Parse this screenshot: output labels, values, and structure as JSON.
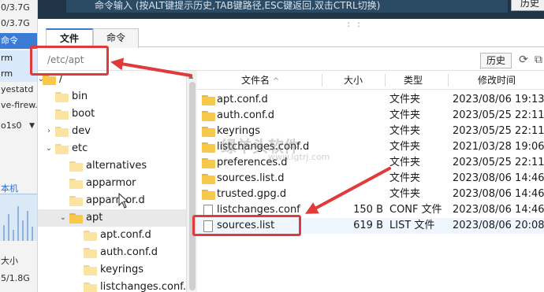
{
  "left_strip": {
    "rows": [
      {
        "text": "0/3.7G"
      },
      {
        "text": "0/3.7G"
      },
      {
        "text": "命令"
      },
      {
        "text": "rm"
      },
      {
        "text": "rm"
      },
      {
        "text": "yestatd"
      },
      {
        "text": "ve-firew."
      },
      {
        "text": "o1s0"
      },
      {
        "text": "本机"
      },
      {
        "text": "大小"
      },
      {
        "text": "5/1.8G"
      }
    ]
  },
  "topbar": {
    "command_input_text": "命令输入 (按ALT键提示历史,TAB键路径,ESC键返回,双击CTRL切换)",
    "history_label": "历史"
  },
  "tabs": [
    {
      "label": "文件",
      "active": true
    },
    {
      "label": "命令",
      "active": false
    }
  ],
  "pathbar": {
    "path": "/etc/apt",
    "history_label": "历史"
  },
  "tree": {
    "items": [
      {
        "label": "/",
        "depth": 0,
        "expanded": true
      },
      {
        "label": "bin",
        "depth": 1
      },
      {
        "label": "boot",
        "depth": 1
      },
      {
        "label": "dev",
        "depth": 1
      },
      {
        "label": "etc",
        "depth": 1,
        "expanded": true
      },
      {
        "label": "alternatives",
        "depth": 2
      },
      {
        "label": "apparmor",
        "depth": 2
      },
      {
        "label": "apparmor.d",
        "depth": 2
      },
      {
        "label": "apt",
        "depth": 2,
        "expanded": true,
        "selected": true
      },
      {
        "label": "apt.conf.d",
        "depth": 3
      },
      {
        "label": "auth.conf.d",
        "depth": 3
      },
      {
        "label": "keyrings",
        "depth": 3
      },
      {
        "label": "listchanges.conf.d",
        "depth": 3
      }
    ]
  },
  "file_list": {
    "headers": {
      "name": "文件名",
      "size": "大小",
      "type": "类型",
      "modified": "修改时间"
    },
    "rows": [
      {
        "name": "apt.conf.d",
        "size": "",
        "type": "文件夹",
        "modified": "2023/08/06 19:13",
        "is_folder": true
      },
      {
        "name": "auth.conf.d",
        "size": "",
        "type": "文件夹",
        "modified": "2023/05/25 22:11",
        "is_folder": true
      },
      {
        "name": "keyrings",
        "size": "",
        "type": "文件夹",
        "modified": "2023/05/25 22:11",
        "is_folder": true
      },
      {
        "name": "listchanges.conf.d",
        "size": "",
        "type": "文件夹",
        "modified": "2021/03/28 19:06",
        "is_folder": true
      },
      {
        "name": "preferences.d",
        "size": "",
        "type": "文件夹",
        "modified": "2023/05/25 22:11",
        "is_folder": true
      },
      {
        "name": "sources.list.d",
        "size": "",
        "type": "文件夹",
        "modified": "2023/08/06 14:46",
        "is_folder": true
      },
      {
        "name": "trusted.gpg.d",
        "size": "",
        "type": "文件夹",
        "modified": "2023/08/06 14:46",
        "is_folder": true
      },
      {
        "name": "listchanges.conf",
        "size": "150 B",
        "type": "CONF 文件",
        "modified": "2023/08/06 14:46",
        "is_folder": false
      },
      {
        "name": "sources.list",
        "size": "619 B",
        "type": "LIST 文件",
        "modified": "2023/08/06 20:08",
        "is_folder": false
      }
    ]
  },
  "watermark": {
    "text": "绿羊头软件",
    "url": "www.lgtrj.com"
  },
  "colors": {
    "annotation_red": "#e03a3a",
    "folder_yellow": "#f7c84a",
    "topbar_bg": "#1f3446",
    "accent_blue": "#3a7bd5"
  }
}
